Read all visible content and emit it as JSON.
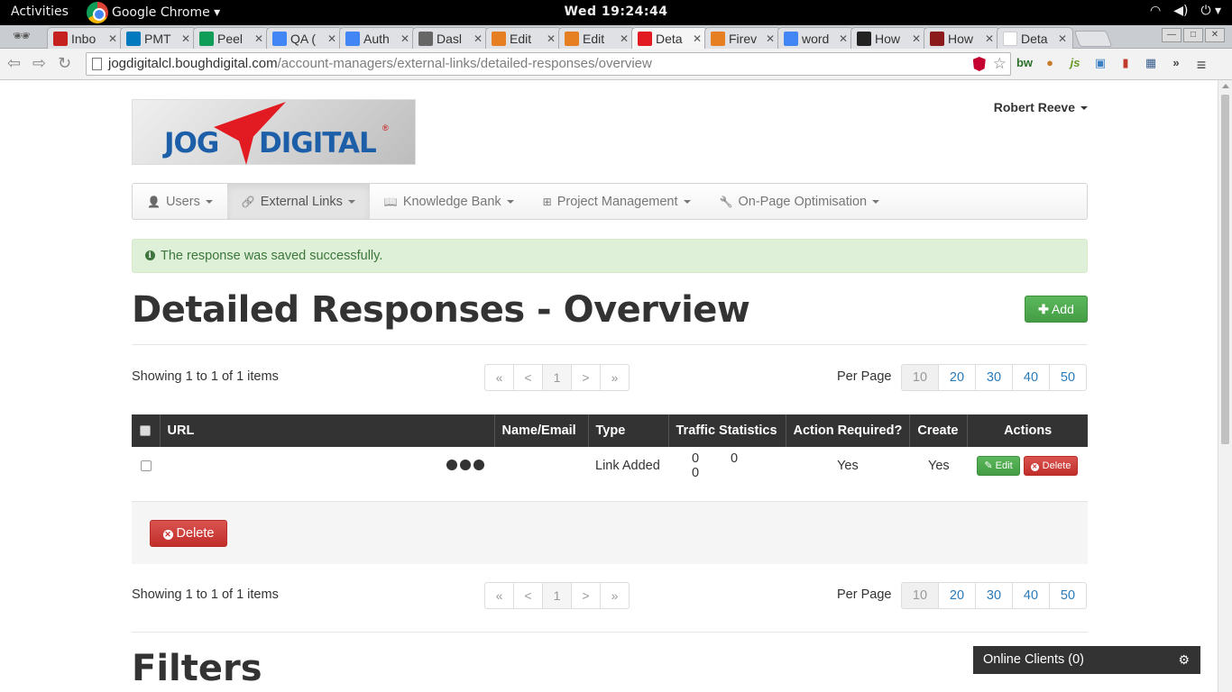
{
  "os": {
    "activities": "Activities",
    "app_name": "Google Chrome ▾",
    "clock": "Wed 19:24:44",
    "icons": [
      "wifi-icon",
      "volume-icon",
      "power-icon"
    ]
  },
  "browser": {
    "tabs": [
      {
        "title": "Inbo",
        "icon": "gmail-icon",
        "color": "#c5221f"
      },
      {
        "title": "PMT",
        "icon": "trello-icon",
        "color": "#0079bf"
      },
      {
        "title": "Peel",
        "icon": "drive-icon",
        "color": "#0f9d58"
      },
      {
        "title": "QA (",
        "icon": "docs-icon",
        "color": "#4285f4"
      },
      {
        "title": "Auth",
        "icon": "docs-icon",
        "color": "#4285f4"
      },
      {
        "title": "Dasl",
        "icon": "bear-icon",
        "color": "#666666"
      },
      {
        "title": "Edit",
        "icon": "puzzle-icon",
        "color": "#e67e22"
      },
      {
        "title": "Edit",
        "icon": "puzzle-icon",
        "color": "#e67e22"
      },
      {
        "title": "Deta",
        "icon": "jog-icon",
        "color": "#e21b23",
        "active": true
      },
      {
        "title": "Firev",
        "icon": "puzzle-icon",
        "color": "#e67e22"
      },
      {
        "title": "word",
        "icon": "google-icon",
        "color": "#4285f4"
      },
      {
        "title": "How",
        "icon": "d-icon",
        "color": "#222222"
      },
      {
        "title": "How",
        "icon": "t-icon",
        "color": "#8b1a1a"
      },
      {
        "title": "Deta",
        "icon": "blank-icon",
        "color": "#ffffff"
      }
    ],
    "url_host": "jogdigitalcl.boughdigital.com",
    "url_path": "/account-managers/external-links/detailed-responses/overview",
    "ext_bw": "bw",
    "ext_js": "js",
    "menu": "≡",
    "overflow": "»"
  },
  "page": {
    "user_name": "Robert Reeve",
    "logo_jog": "JOG",
    "logo_digital": "DIGITAL",
    "nav": [
      {
        "label": "Users",
        "icon": "user-icon"
      },
      {
        "label": "External Links",
        "icon": "link-icon",
        "active": true
      },
      {
        "label": "Knowledge Bank",
        "icon": "book-icon"
      },
      {
        "label": "Project Management",
        "icon": "sitemap-icon"
      },
      {
        "label": "On-Page Optimisation",
        "icon": "wrench-icon"
      }
    ],
    "alert": "The response was saved successfully.",
    "title": "Detailed Responses - Overview",
    "add_label": "Add",
    "showing": "Showing 1 to 1 of 1 items",
    "pager": [
      "«",
      "<",
      "1",
      ">",
      "»"
    ],
    "per_page_label": "Per Page",
    "per_page_options": [
      "10",
      "20",
      "30",
      "40",
      "50"
    ],
    "table": {
      "headers": [
        "URL",
        "Name/Email",
        "Type",
        "Traffic Statistics",
        "Action Required?",
        "Create",
        "Actions"
      ],
      "row": {
        "type": "Link Added",
        "traffic": [
          "0",
          "0",
          "0"
        ],
        "action_required": "Yes",
        "create": "Yes",
        "edit_label": "Edit",
        "delete_label": "Delete"
      }
    },
    "bulk_delete_label": "Delete",
    "filters_title": "Filters",
    "online_clients": "Online Clients (0)"
  },
  "colors": {
    "success": "#5cb85c",
    "danger": "#d9534f",
    "link": "#2a7ab8",
    "alert_bg": "#dff0d8"
  }
}
